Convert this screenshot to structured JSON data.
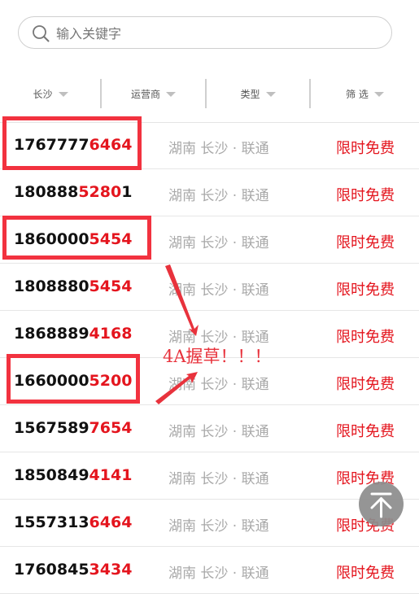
{
  "search": {
    "placeholder": "输入关键字"
  },
  "filters": [
    {
      "label": "长沙"
    },
    {
      "label": "运营商"
    },
    {
      "label": "类型"
    },
    {
      "label": "筛 选"
    }
  ],
  "rows": [
    {
      "prefix": "1767777",
      "suffix": "6464",
      "tail": "",
      "location": "湖南 长沙 · 联通",
      "tag": "限时免费"
    },
    {
      "prefix": "180888",
      "suffix": "5280",
      "tail": "1",
      "location": "湖南 长沙 · 联通",
      "tag": "限时免费"
    },
    {
      "prefix": "1860000",
      "suffix": "5454",
      "tail": "",
      "location": "湖南 长沙 · 联通",
      "tag": "限时免费"
    },
    {
      "prefix": "1808880",
      "suffix": "5454",
      "tail": "",
      "location": "湖南 长沙 · 联通",
      "tag": "限时免费"
    },
    {
      "prefix": "1868889",
      "suffix": "4168",
      "tail": "",
      "location": "湖南 长沙 · 联通",
      "tag": "限时免费"
    },
    {
      "prefix": "1660000",
      "suffix": "5200",
      "tail": "",
      "location": "湖南 长沙 · 联通",
      "tag": "限时免费"
    },
    {
      "prefix": "1567589",
      "suffix": "7654",
      "tail": "",
      "location": "湖南 长沙 · 联通",
      "tag": "限时免费"
    },
    {
      "prefix": "1850849",
      "suffix": "4141",
      "tail": "",
      "location": "湖南 长沙 · 联通",
      "tag": "限时免费"
    },
    {
      "prefix": "1557313",
      "suffix": "6464",
      "tail": "",
      "location": "湖南 长沙 · 联通",
      "tag": "限时免费"
    },
    {
      "prefix": "1760845",
      "suffix": "3434",
      "tail": "",
      "location": "湖南 长沙 · 联通",
      "tag": "限时免费"
    }
  ],
  "annotation": {
    "text": "4A握草！！！"
  },
  "colors": {
    "accent": "#e4151e",
    "highlight": "#f2323f",
    "muted": "#a9a9a9"
  },
  "icons": {
    "search": "search-icon",
    "back_to_top": "arrow-up-icon"
  }
}
